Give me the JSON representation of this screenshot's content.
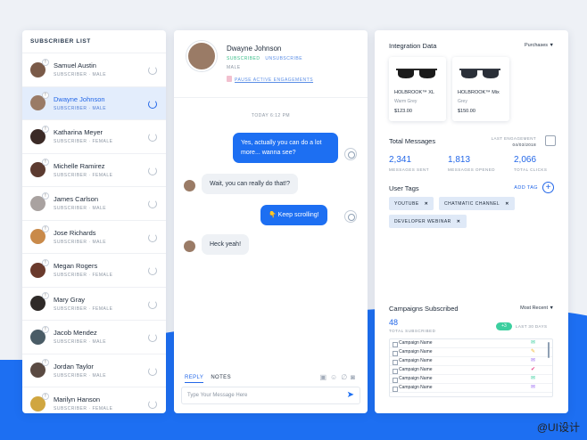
{
  "subscribers": {
    "title": "SUBSCRIBER LIST",
    "items": [
      {
        "name": "Samuel Austin",
        "meta": "SUBSCRIBER · MALE",
        "active": false,
        "avatar_color": "#7a5a48"
      },
      {
        "name": "Dwayne Johnson",
        "meta": "SUBSCRIBER · MALE",
        "active": true,
        "avatar_color": "#9a7b66"
      },
      {
        "name": "Katharina Meyer",
        "meta": "SUBSCRIBER · FEMALE",
        "active": false,
        "avatar_color": "#3b2a26"
      },
      {
        "name": "Michelle Ramirez",
        "meta": "SUBSCRIBER · FEMALE",
        "active": false,
        "avatar_color": "#5c3b30"
      },
      {
        "name": "James Carlson",
        "meta": "SUBSCRIBER · MALE",
        "active": false,
        "avatar_color": "#a9a2a0"
      },
      {
        "name": "Jose Richards",
        "meta": "SUBSCRIBER · MALE",
        "active": false,
        "avatar_color": "#c98a4a"
      },
      {
        "name": "Megan Rogers",
        "meta": "SUBSCRIBER · FEMALE",
        "active": false,
        "avatar_color": "#6a3a2c"
      },
      {
        "name": "Mary Gray",
        "meta": "SUBSCRIBER · FEMALE",
        "active": false,
        "avatar_color": "#2f2a28"
      },
      {
        "name": "Jacob Mendez",
        "meta": "SUBSCRIBER · MALE",
        "active": false,
        "avatar_color": "#4a5c66"
      },
      {
        "name": "Jordan Taylor",
        "meta": "SUBSCRIBER · MALE",
        "active": false,
        "avatar_color": "#5a4a42"
      },
      {
        "name": "Marilyn Hanson",
        "meta": "SUBSCRIBER · FEMALE",
        "active": false,
        "avatar_color": "#d0a640"
      }
    ]
  },
  "chat": {
    "name": "Dwayne Johnson",
    "tag_subscriber": "SUBSCRIBED",
    "tag_unsubscribe": "UNSUBSCRIBE",
    "gender": "MALE",
    "pause_label": "PAUSE ACTIVE ENGAGEMENTS",
    "time": "TODAY 6:12 PM",
    "messages": [
      {
        "text": "Yes, actually you can do a lot more... wanna see?",
        "dir": "out"
      },
      {
        "text": "Wait, you can really do that!?",
        "dir": "in"
      },
      {
        "text": "👇 Keep scrolling!",
        "dir": "out"
      },
      {
        "text": "Heck yeah!",
        "dir": "in"
      }
    ],
    "tabs": [
      "REPLY",
      "NOTES"
    ],
    "input_placeholder": "Type Your Message Here"
  },
  "integration": {
    "title": "Integration Data",
    "dropdown": "Purchases",
    "products": [
      {
        "name": "HOLBROOK™ XL",
        "sub": "Warm Grey",
        "price": "$123.00"
      },
      {
        "name": "HOLBROOK™ Mix",
        "sub": "Grey",
        "price": "$150.00"
      }
    ]
  },
  "messages_stats": {
    "title": "Total Messages",
    "last_engagement_label": "LAST ENGAGEMENT",
    "last_engagement_date": "04/03/2018",
    "stats": [
      {
        "value": "2,341",
        "label": "MESSAGES SENT"
      },
      {
        "value": "1,813",
        "label": "MESSAGES OPENED"
      },
      {
        "value": "2,066",
        "label": "TOTAL CLICKS"
      }
    ]
  },
  "tags": {
    "title": "User Tags",
    "add_label": "ADD TAG",
    "items": [
      "YOUTUBE",
      "CHATMATIC CHANNEL",
      "DEVELOPER WEBINAR"
    ]
  },
  "campaigns": {
    "title": "Campaigns Subscribed",
    "dropdown": "Most Recent",
    "count": "48",
    "count_label": "TOTAL SUBSCRIBED",
    "pill": "+3",
    "range_label": "LAST 30 DAYS",
    "rows": [
      {
        "name": "Campaign Name",
        "icon": "✉",
        "icon_color": "#3ccf9f"
      },
      {
        "name": "Campaign Name",
        "icon": "✎",
        "icon_color": "#f0b429"
      },
      {
        "name": "Campaign Name",
        "icon": "✉",
        "icon_color": "#9b6bf2"
      },
      {
        "name": "Campaign Name",
        "icon": "✔",
        "icon_color": "#e8468a"
      },
      {
        "name": "Campaign Name",
        "icon": "✉",
        "icon_color": "#3ccf9f"
      },
      {
        "name": "Campaign Name",
        "icon": "✉",
        "icon_color": "#9b6bf2"
      }
    ]
  },
  "watermark": "@UI设计",
  "colors": {
    "accent": "#1d6ff2",
    "green": "#3ccf9f"
  }
}
